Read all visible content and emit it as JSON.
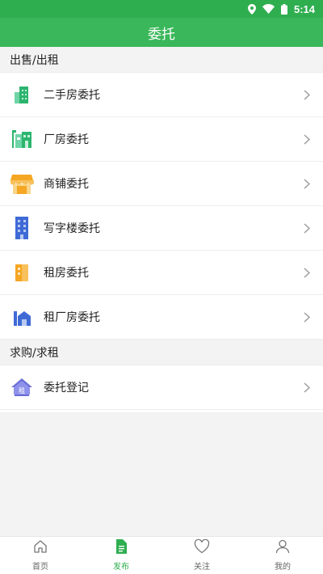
{
  "status": {
    "time": "5:14"
  },
  "header": {
    "title": "委托"
  },
  "sections": [
    {
      "title": "出售/出租",
      "items": [
        {
          "label": "二手房委托",
          "icon": "second-hand-house-icon"
        },
        {
          "label": "厂房委托",
          "icon": "factory-icon"
        },
        {
          "label": "商铺委托",
          "icon": "shop-icon"
        },
        {
          "label": "写字楼委托",
          "icon": "office-building-icon"
        },
        {
          "label": "租房委托",
          "icon": "rental-house-icon"
        },
        {
          "label": "租厂房委托",
          "icon": "rent-factory-icon"
        }
      ]
    },
    {
      "title": "求购/求租",
      "items": [
        {
          "label": "委托登记",
          "icon": "register-house-icon",
          "badge": "租"
        }
      ]
    }
  ],
  "tabbar": {
    "items": [
      {
        "label": "首页",
        "icon": "home-icon",
        "active": false
      },
      {
        "label": "发布",
        "icon": "publish-document-icon",
        "active": true
      },
      {
        "label": "关注",
        "icon": "heart-icon",
        "active": false
      },
      {
        "label": "我的",
        "icon": "user-icon",
        "active": false
      }
    ]
  },
  "colors": {
    "brand": "#3ab75a",
    "status_bar": "#2fae50",
    "active_tab": "#2fae50",
    "inactive_tab": "#666666"
  }
}
